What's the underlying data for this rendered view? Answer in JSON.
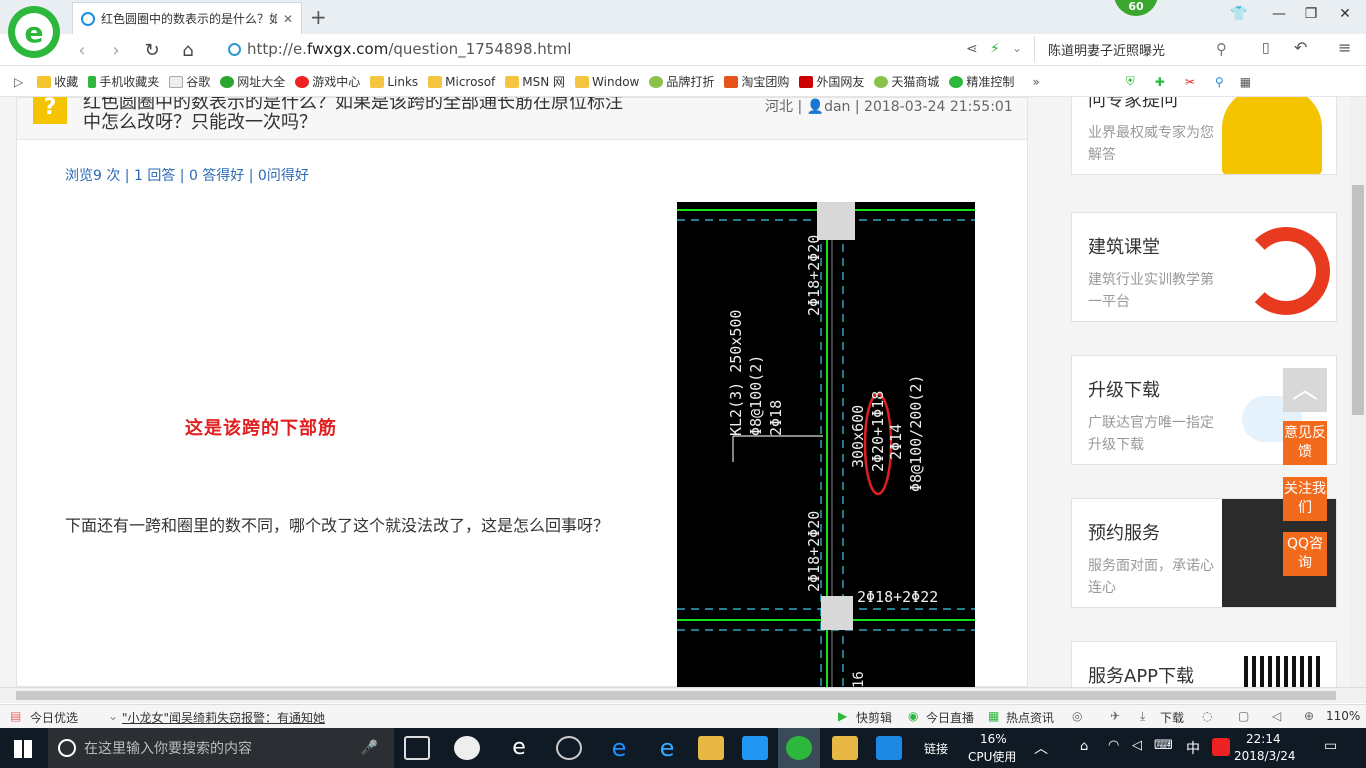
{
  "browser": {
    "tab_title": "红色圆圈中的数表示的是什么？如",
    "tab_close": "✕",
    "new_tab": "+",
    "badge": "60",
    "url_prefix": "http://e.",
    "url_domain": "fwxgx.com",
    "url_path": "/question_1754898.html",
    "search_text": "陈道明妻子近照曝光"
  },
  "bookmarks": [
    "收藏",
    "手机收藏夹",
    "谷歌",
    "网址大全",
    "游戏中心",
    "Links",
    "Microsof",
    "MSN 网",
    "Window",
    "品牌打折",
    "淘宝团购",
    "外国网友",
    "天猫商城",
    "精准控制"
  ],
  "question": {
    "title_line1": "红色圆圈中的数表示的是什么？如果是该跨的全部通长筋在原位标注",
    "title_line2": "中怎么改呀？只能改一次吗？",
    "location": "河北",
    "user": "dan",
    "date": "2018-03-24 21:55:01",
    "stats": "浏览9 次 | 1 回答 | 0 答得好 | 0问得好",
    "red_note": "这是该跨的下部筋",
    "body": "下面还有一跨和圈里的数不同，哪个改了这个就没法改了，这是怎么回事呀？"
  },
  "cad": {
    "label_top_rebar": "2Φ18+2Φ20",
    "label_beam_1": "KL2(3) 250x500",
    "label_beam_2": "Φ8@100(2)",
    "label_beam_3": "2Φ18",
    "label_mid_1": "300x600",
    "label_mid_2": "2Φ20+1Φ18",
    "label_mid_3": "2Φ14",
    "label_mid_4": "Φ8@100/200(2)",
    "label_lower_rebar": "2Φ18+2Φ20",
    "label_bottom": "2Φ18+2Φ22",
    "label_edge": "16"
  },
  "sidebar": [
    {
      "title": "问专家提问",
      "sub": "业界最权威专家为您解答"
    },
    {
      "title": "建筑课堂",
      "sub": "建筑行业实训教学第一平台"
    },
    {
      "title": "升级下载",
      "sub": "广联达官方唯一指定升级下载"
    },
    {
      "title": "预约服务",
      "sub": "服务面对面，承诺心连心"
    },
    {
      "title": "服务APP下载",
      "sub": ""
    }
  ],
  "float_buttons": [
    "意见反馈",
    "关注我们",
    "QQ咨询"
  ],
  "statusbar": {
    "left1": "今日优选",
    "news": "\"小龙女\"闻吴绮莉失窃报警：有通知她",
    "items": [
      "快剪辑",
      "今日直播",
      "热点资讯",
      "下载"
    ],
    "zoom": "110%"
  },
  "taskbar": {
    "search_placeholder": "在这里输入你要搜索的内容",
    "link_label": "链接",
    "cpu_pct": "16%",
    "cpu_label": "CPU使用",
    "ime": "中",
    "time": "22:14",
    "date": "2018/3/24"
  }
}
